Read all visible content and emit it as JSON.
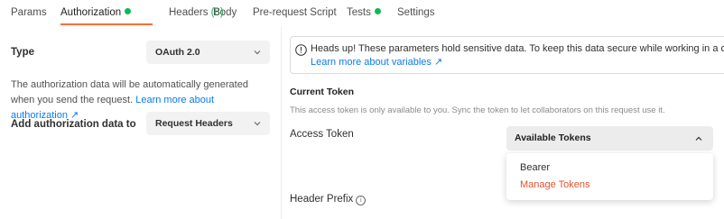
{
  "tabs": [
    {
      "label": "Params"
    },
    {
      "label": "Authorization",
      "status_dot": "green"
    },
    {
      "label": "Headers",
      "count": "(8)"
    },
    {
      "label": "Body"
    },
    {
      "label": "Pre-request Script"
    },
    {
      "label": "Tests",
      "status_dot": "green"
    },
    {
      "label": "Settings"
    }
  ],
  "left": {
    "type_label": "Type",
    "type_value": "OAuth 2.0",
    "description": "The authorization data will be automatically generated when you send the request.",
    "learn_more": "Learn more about authorization ↗",
    "add_to_label": "Add authorization data to",
    "add_to_value": "Request Headers"
  },
  "notice": {
    "text": "Heads up! These parameters hold sensitive data. To keep this data secure while working in a collab",
    "link": "Learn more about variables ↗"
  },
  "current_token": {
    "heading": "Current Token",
    "hint": "This access token is only available to you. Sync the token to let collaborators on this request use it.",
    "access_token_label": "Access Token",
    "select_value": "Available Tokens",
    "menu": [
      {
        "label": "Bearer"
      },
      {
        "label": "Manage Tokens"
      }
    ],
    "header_prefix_label": "Header Prefix",
    "info_glyph": "i"
  },
  "colors": {
    "accent": "#ff6c37",
    "status_green": "#0cbb52",
    "link": "#097bed",
    "manage": "#e0532e"
  }
}
